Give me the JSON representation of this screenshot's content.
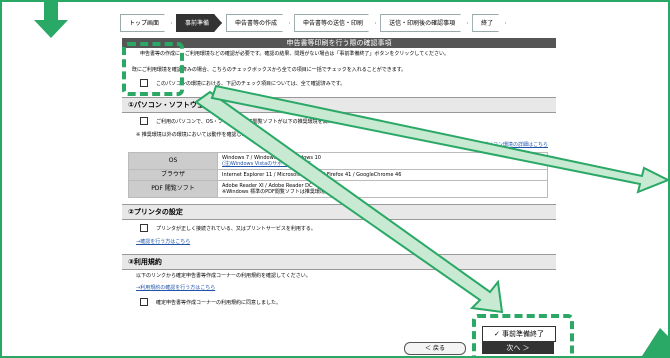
{
  "steps": [
    {
      "label": "トップ画面",
      "active": false
    },
    {
      "label": "事前準備",
      "active": true
    },
    {
      "label": "申告書等の作成",
      "active": false
    },
    {
      "label": "申告書等の送信・印刷",
      "active": false
    },
    {
      "label": "送信・印刷後の確認事項",
      "active": false
    },
    {
      "label": "終了",
      "active": false
    }
  ],
  "page_title": "申告書等印刷を行う際の確認事項",
  "intro_text": "申告書等の作成に、ご利用環境などの確認が必要です。確認の結果、問題がない場合は「事前準備終了」ボタンをクリックしてください。",
  "note_text": "既にご利用環境を確認済みの場合、こちらのチェックボックスから全ての項目に一括でチェックを入れることができます。",
  "all_check_label": "このパソコンの環境における、下記のチェック項目については、全て確認済みです。",
  "section1": {
    "title": "①パソコン・ソフトウェア",
    "check_text": "ご利用のパソコンで、OS・ブラウザ・PDF閲覧ソフトが以下の推奨環境を満たしている。",
    "sub_note": "※ 推奨環境以外の環境においては動作を確認した環境です。",
    "detail_link": "→パソコン環境の詳細はこちら",
    "rows": [
      {
        "key": "OS",
        "value": "Windows 7 / Windows 8.1 / Windows 10",
        "extra": "(注)Windows Vistaのサポートはこちら"
      },
      {
        "key": "ブラウザ",
        "value": "Internet Explorer 11 / Microsoft Edge 20 / Firefox 41 / GoogleChrome 46",
        "extra": ""
      },
      {
        "key": "PDF 閲覧ソフト",
        "value": "Adobe Reader XI / Adobe Reader DC",
        "extra": "※Windows 標準のPDF閲覧ソフトは推奨環境外です。"
      }
    ]
  },
  "section2": {
    "title": "②プリンタの設定",
    "check_text": "プリンタが正しく接続されている、又はプリントサービスを利用する。",
    "link": "→確認を行う方はこちら"
  },
  "section3": {
    "title": "③利用規約",
    "body": "以下のリンクから確定申告書等作成コーナーの利用規約を確認してください。",
    "link": "→利用規約の確認を行う方はこちら",
    "check_text": "確定申告書等作成コーナーの利用規約に同意しました。"
  },
  "buttons": {
    "back": "＜ 戻る",
    "done": "✓ 事前準備終了",
    "next": "次へ ＞"
  }
}
